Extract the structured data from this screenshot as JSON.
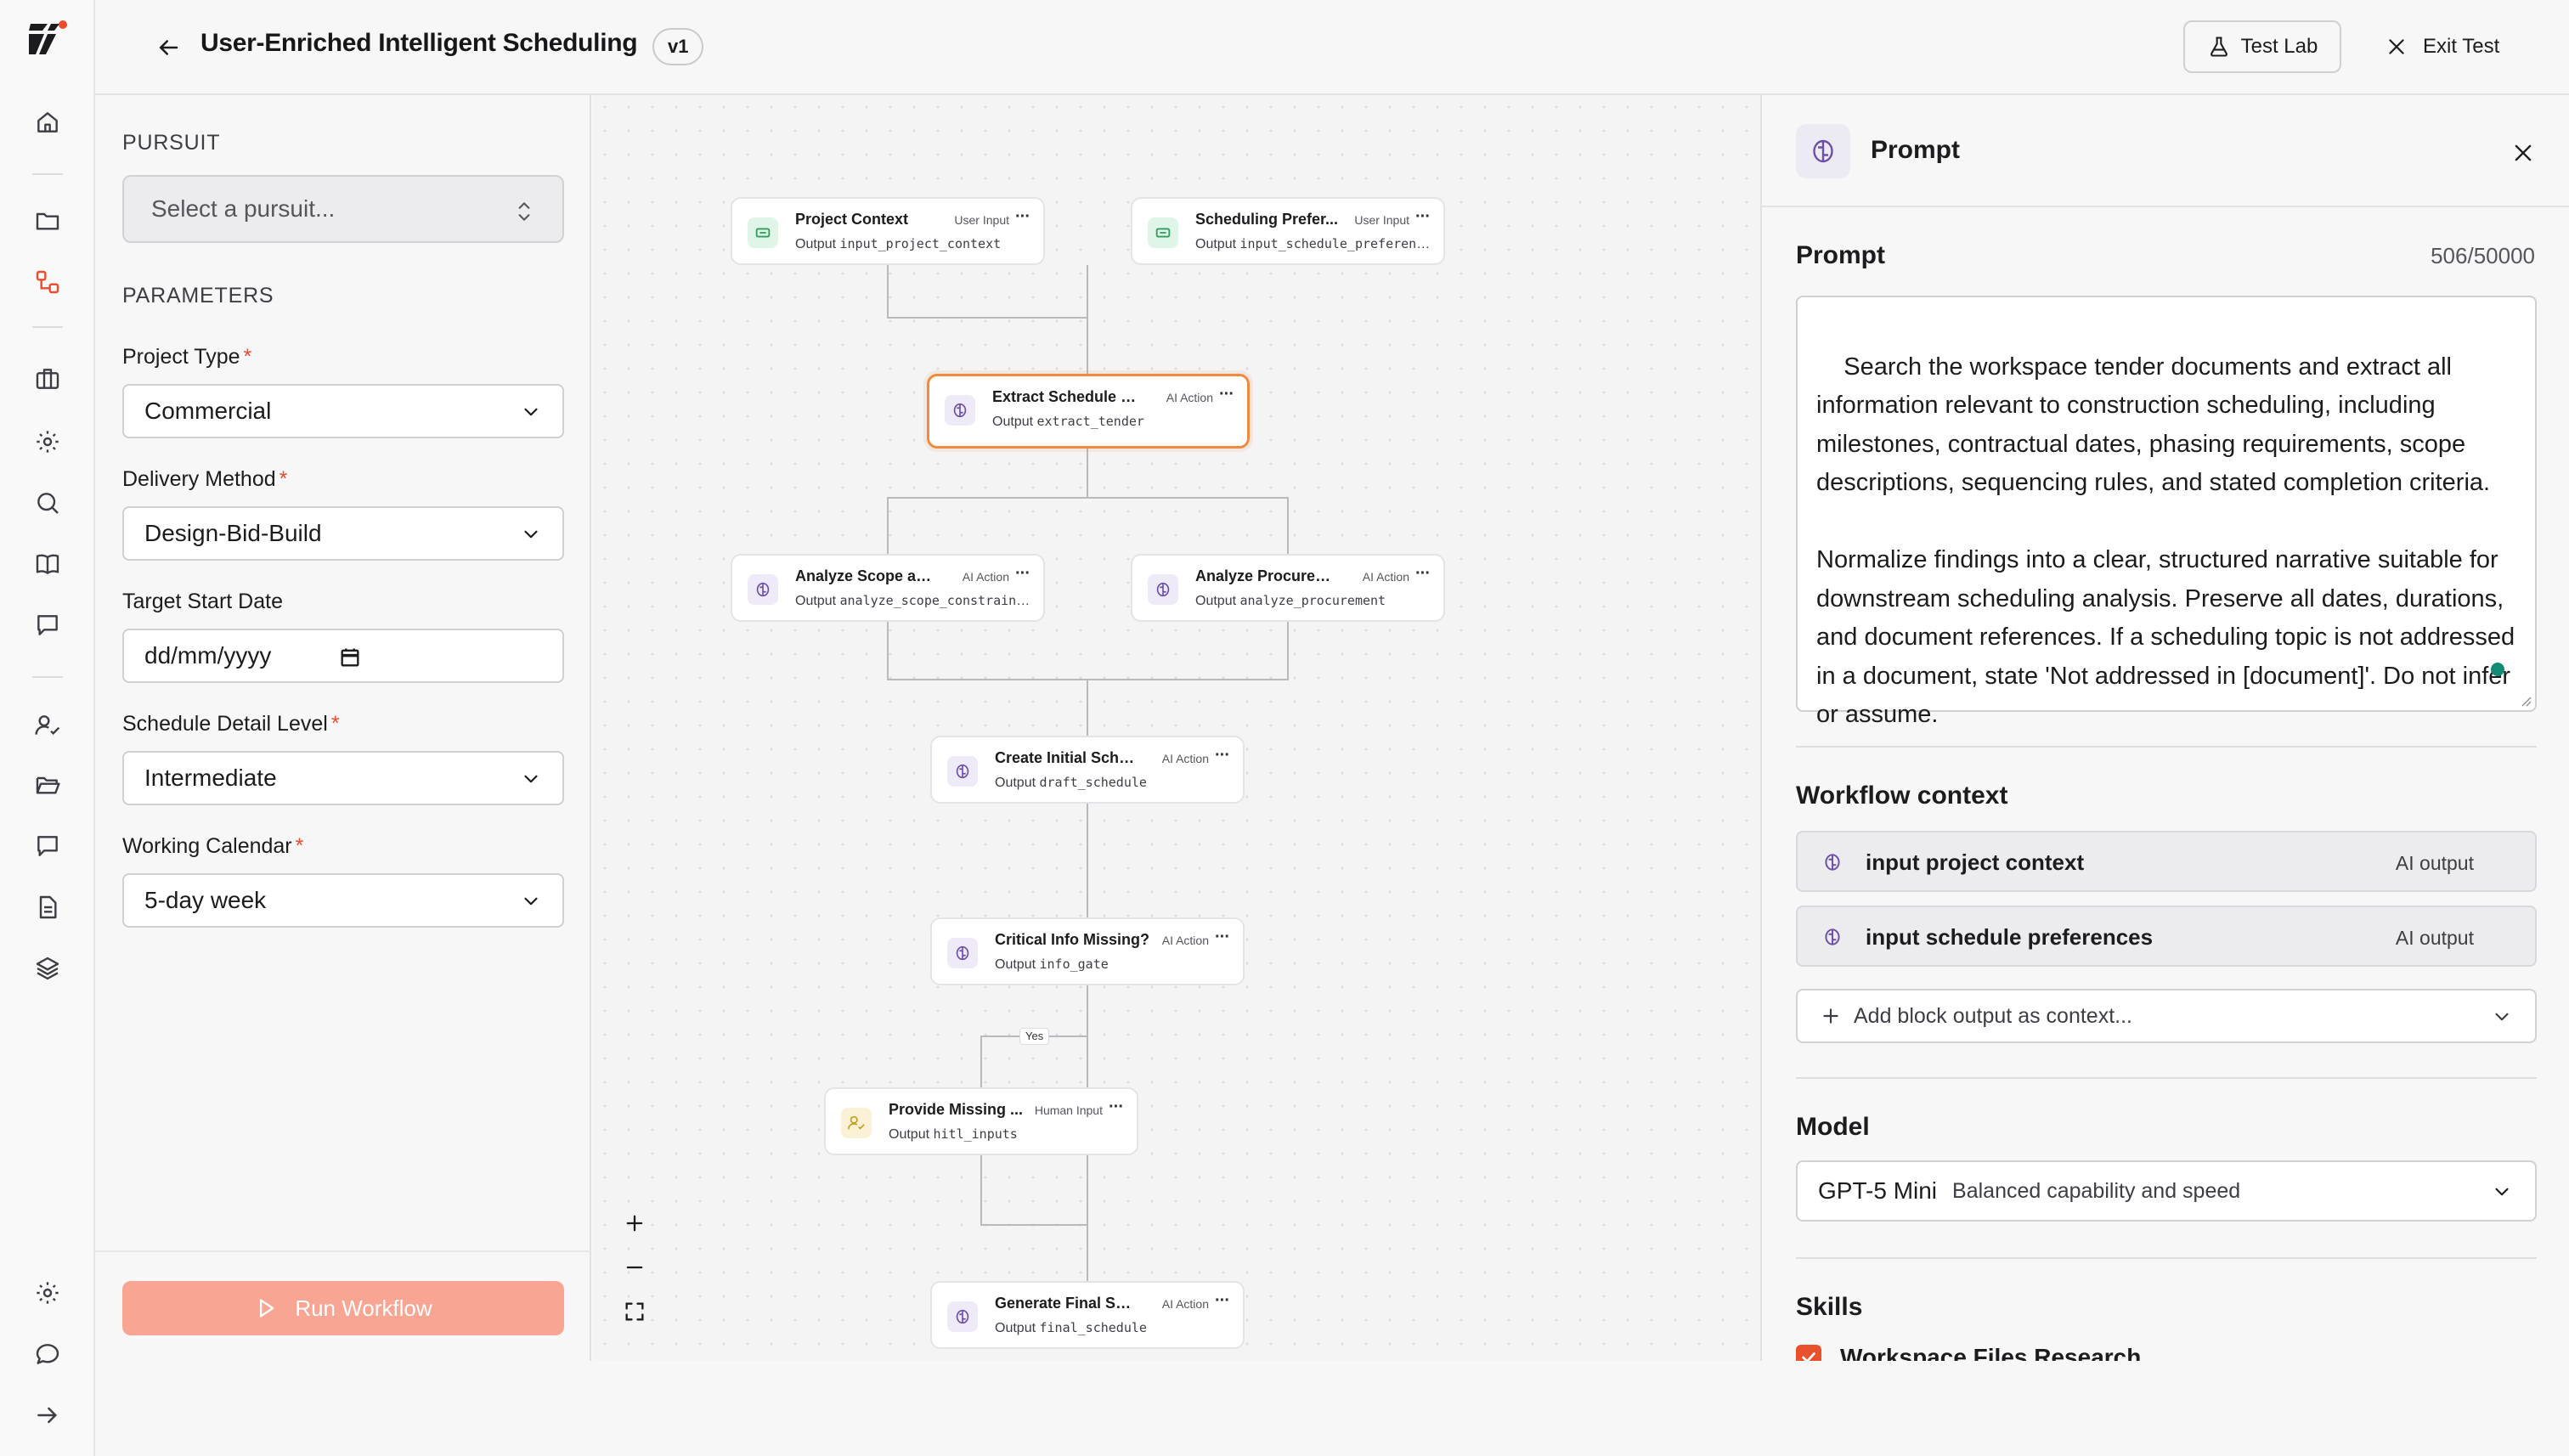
{
  "header": {
    "title": "User-Enriched Intelligent Scheduling",
    "version": "v1",
    "test_lab_label": "Test Lab",
    "exit_test_label": "Exit Test"
  },
  "params": {
    "pursuit_section": "PURSUIT",
    "pursuit_placeholder": "Select a pursuit...",
    "parameters_section": "PARAMETERS",
    "fields": [
      {
        "label": "Project Type",
        "required": "*",
        "value": "Commercial"
      },
      {
        "label": "Delivery Method",
        "required": "*",
        "value": "Design-Bid-Build"
      },
      {
        "label": "Target Start Date",
        "required": "",
        "value": "dd/mm/yyyy"
      },
      {
        "label": "Schedule Detail Level",
        "required": "*",
        "value": "Intermediate"
      },
      {
        "label": "Working Calendar",
        "required": "*",
        "value": "5-day week"
      }
    ],
    "run_label": "Run Workflow"
  },
  "canvas": {
    "output_prefix": "Output",
    "yes_label": "Yes",
    "nodes": [
      {
        "title": "Project Context",
        "type": "User Input",
        "output": "input_project_context",
        "kind": "input"
      },
      {
        "title": "Scheduling Prefer...",
        "type": "User Input",
        "output": "input_schedule_preferen...",
        "kind": "input"
      },
      {
        "title": "Extract Schedule I...",
        "type": "AI Action",
        "output": "extract_tender",
        "kind": "ai"
      },
      {
        "title": "Analyze Scope and...",
        "type": "AI Action",
        "output": "analyze_scope_constrain...",
        "kind": "ai"
      },
      {
        "title": "Analyze Procurem...",
        "type": "AI Action",
        "output": "analyze_procurement",
        "kind": "ai"
      },
      {
        "title": "Create Initial Sche...",
        "type": "AI Action",
        "output": "draft_schedule",
        "kind": "ai"
      },
      {
        "title": "Critical Info Missing?",
        "type": "AI Action",
        "output": "info_gate",
        "kind": "ai"
      },
      {
        "title": "Provide Missing ...",
        "type": "Human Input",
        "output": "hitl_inputs",
        "kind": "human"
      },
      {
        "title": "Generate Final Sch...",
        "type": "AI Action",
        "output": "final_schedule",
        "kind": "ai"
      }
    ]
  },
  "panel": {
    "title": "Prompt",
    "prompt_label": "Prompt",
    "char_count": "506/50000",
    "prompt_text": "Search the workspace tender documents and extract all information relevant to construction scheduling, including milestones, contractual dates, phasing requirements, scope descriptions, sequencing rules, and stated completion criteria.\n\nNormalize findings into a clear, structured narrative suitable for downstream scheduling analysis. Preserve all dates, durations, and document references. If a scheduling topic is not addressed in a document, state 'Not addressed in [document]'. Do not infer or assume.",
    "workflow_context_label": "Workflow context",
    "context_items": [
      {
        "name": "input project context",
        "tag": "AI output"
      },
      {
        "name": "input schedule preferences",
        "tag": "AI output"
      }
    ],
    "add_context_label": "Add block output as context...",
    "model_label": "Model",
    "model_name": "GPT-5 Mini",
    "model_desc": "Balanced capability and speed",
    "skills_label": "Skills",
    "skill_name": "Workspace Files Research"
  },
  "colors": {
    "accent": "#ef4b2d",
    "run_button": "#f8a593",
    "selected_node_border": "#f08a3e",
    "status_dot": "#138a74"
  },
  "icons": {
    "rail": [
      "home-icon",
      "folder-icon",
      "workflow-icon",
      "briefcase-icon",
      "settings-icon",
      "search-icon",
      "book-icon",
      "chat-icon",
      "user-check-icon",
      "folder-open-icon",
      "message-icon",
      "document-icon",
      "layers-icon",
      "gear-icon",
      "chat-bubble-icon",
      "arrow-right-icon"
    ]
  }
}
